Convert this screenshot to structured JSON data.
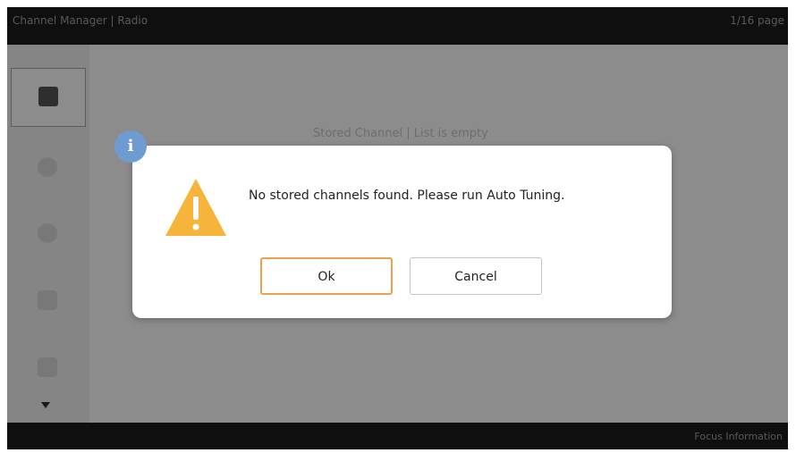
{
  "topbar": {
    "title": "Channel Manager | Radio",
    "page": "1/16 page"
  },
  "leftbar": {
    "tiles": [
      {
        "icon": "square-icon",
        "active": true
      },
      {
        "icon": "circle-icon"
      },
      {
        "icon": "circle-icon"
      },
      {
        "icon": "rounded-square-icon"
      },
      {
        "icon": "rounded-square-icon"
      }
    ],
    "scroll_icon": "triangle-down-icon"
  },
  "content": {
    "subtitle": "Stored Channel | List is empty"
  },
  "bottombar": {
    "hint": "Focus Information"
  },
  "dialog": {
    "badge_icon": "info-icon",
    "badge_glyph": "i",
    "warning_icon": "warning-triangle-icon",
    "message": "No stored channels found. Please run Auto Tuning.",
    "ok_label": "Ok",
    "cancel_label": "Cancel"
  },
  "colors": {
    "accent": "#f0a04b",
    "warning": "#f6b53a",
    "info": "#6e9bd1",
    "bar": "#0f0f0f",
    "dim": "#8c8c8c"
  }
}
